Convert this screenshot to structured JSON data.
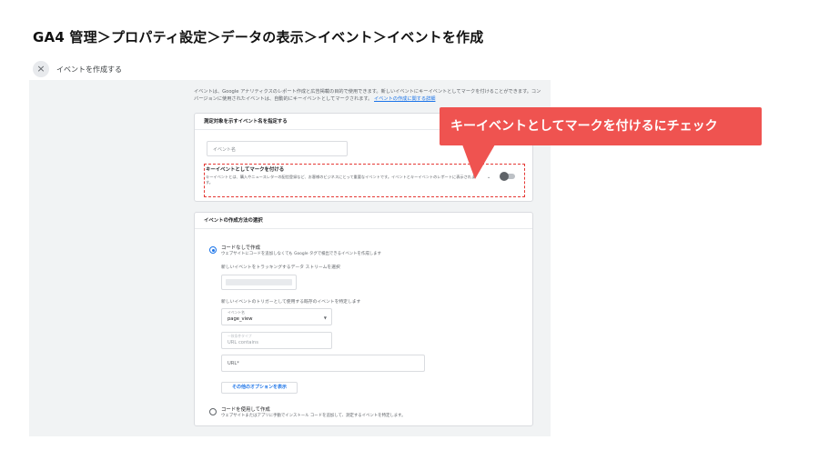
{
  "slide_title": "GA4 管理＞プロパティ設定＞データの表示＞イベント＞イベントを作成",
  "topbar": {
    "close_icon": "×",
    "title": "イベントを作成する"
  },
  "info": {
    "text": "イベントは、Google アナリティクスのレポート作成と広告掲載の目的で使用できます。新しいイベントにキーイベントとしてマークを付けることができます。コンバージョンに使用されたイベントは、自動的にキーイベントとしてマークされます。",
    "link": "イベントの作成に関する詳細"
  },
  "card1": {
    "header": "測定対象を示すイベント名を指定する",
    "event_name_placeholder": "イベント名",
    "key_title": "キーイベントとしてマークを付ける",
    "key_desc": "キーイベントとは、購入やニュースレターの配信登録など、お客様のビジネスにとって重要なイベントです。イベントとキーイベントのレポートに表示されます。",
    "chevron": "⌄"
  },
  "card2": {
    "header": "イベントの作成方法の選択",
    "option1_title": "コードなしで作成",
    "option1_desc": "ウェブサイトにコードを追加しなくても Google タグで検出できるイベントを作成します",
    "stream_label": "新しいイベントをトラッキングするデータ ストリームを選択",
    "trigger_label": "新しいイベントのトリガーとして使用する既存のイベントを特定します",
    "event_field_label": "イベント名",
    "event_field_value": "page_view",
    "match_field_label": "一致条件タイプ",
    "match_field_value": "URL contains",
    "url_field_value": "URL*",
    "more_button": "その他のオプションを表示",
    "option2_title": "コードを使用して作成",
    "option2_desc": "ウェブサイトまたはアプリに手動でインストール コードを追加して、測定するイベントを特定します。"
  },
  "callout": {
    "text": "キーイベントとしてマークを付けるにチェック"
  },
  "colors": {
    "accent": "#1a73e8",
    "callout": "#ef5350",
    "dashed": "#e53935"
  }
}
